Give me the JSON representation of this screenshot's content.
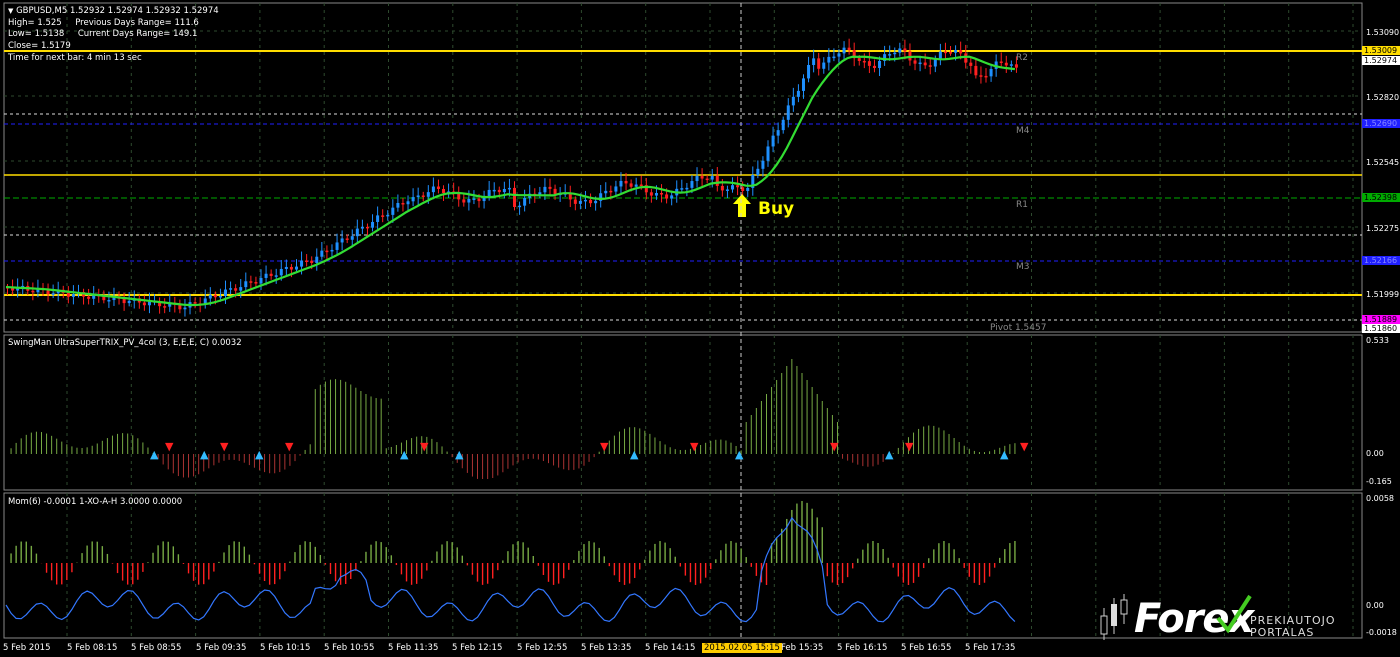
{
  "symbol_header": "GBPUSD,M5  1.52932 1.52974 1.52932 1.52974",
  "info": {
    "line1": "High= 1.525     Previous Days Range= 111.6",
    "line2": "Low= 1.5138     Current Days Range= 149.1",
    "line3": "Close= 1.5179",
    "line4": "Time for next bar: 4 min 13 sec"
  },
  "price_axis": [
    "1.53090",
    "1.52820",
    "1.52545",
    "1.52275",
    "1.51999"
  ],
  "price_tags": {
    "top_yellow": "1.53009",
    "current": "1.52974",
    "blue_top": "1.52690",
    "green": "1.52398",
    "blue_low": "1.52166",
    "magenta": "1.51889",
    "bottom": "1.51860"
  },
  "levels": {
    "r2": "R2",
    "m4": "M4",
    "r1": "R1",
    "m3": "M3",
    "pivot": "Pivot  1.5457"
  },
  "buy_label": "Buy",
  "trix_panel": {
    "title": "SwingMan UltraSuperTRIX_PV_4col (3, E,E,E, C) 0.0032",
    "axis": [
      "0.533",
      "0.00",
      "-0.165"
    ]
  },
  "mom_panel": {
    "title": "Mom(6) -0.0001  1-XO-A-H 3.0000 0.0000",
    "axis": [
      "0.0058",
      "0.00",
      "-0.0018"
    ]
  },
  "time_axis": [
    "5 Feb 2015",
    "5 Feb 08:15",
    "5 Feb 08:55",
    "5 Feb 09:35",
    "5 Feb 10:15",
    "5 Feb 10:55",
    "5 Feb 11:35",
    "5 Feb 12:15",
    "5 Feb 12:55",
    "5 Feb 13:35",
    "5 Feb 14:15",
    "Feb 15:35",
    "5 Feb 16:15",
    "5 Feb 16:55",
    "5 Feb 17:35"
  ],
  "crosshair_time": "2015.02.05 15:15",
  "logo": {
    "main": "Forex",
    "sub1": "PREKIAUTOJO",
    "sub2": "PORTALAS"
  },
  "colors": {
    "bull": "#1e90ff",
    "bear": "#ff2020",
    "ma": "#33dd33",
    "level_yellow": "#ffdd00",
    "level_blue": "#2020ff",
    "level_green": "#00aa00",
    "level_magenta": "#ff00ff",
    "trix_up": "#77aa44",
    "trix_down": "#aa3333",
    "mom_line": "#3377ff"
  }
}
